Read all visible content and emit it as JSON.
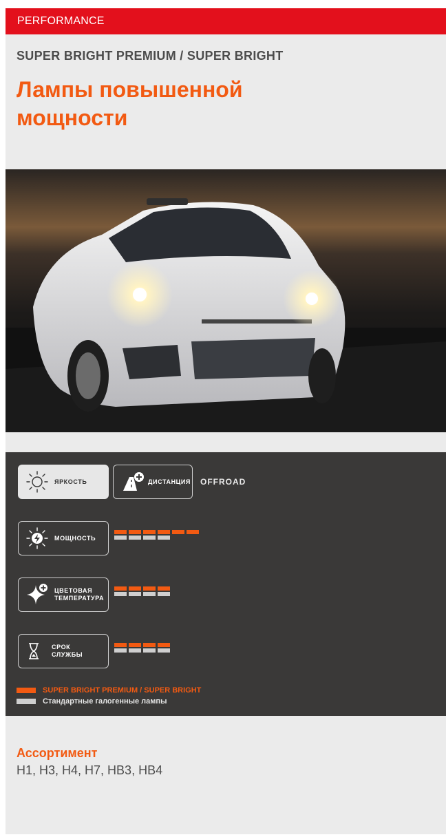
{
  "header": {
    "category": "PERFORMANCE"
  },
  "product": {
    "subtitle": "SUPER BRIGHT PREMIUM / SUPER BRIGHT",
    "title": "Лампы повышенной мощности"
  },
  "features": {
    "brightness_label": "ЯРКОСТЬ",
    "distance_label": "ДИСТАНЦИЯ",
    "offroad_label": "OFFROAD",
    "power": {
      "label": "МОЩНОСТЬ",
      "product_level": 6,
      "standard_level": 4
    },
    "color_temp": {
      "label_line1": "ЦВЕТОВАЯ",
      "label_line2": "ТЕМПЕРАТУРА",
      "product_level": 4,
      "standard_level": 4
    },
    "lifetime": {
      "label_line1": "СРОК",
      "label_line2": "СЛУЖБЫ",
      "product_level": 4,
      "standard_level": 4
    }
  },
  "legend": {
    "product": "SUPER BRIGHT PREMIUM / SUPER BRIGHT",
    "standard": "Стандартные галогенные лампы"
  },
  "assortment": {
    "heading": "Ассортимент",
    "values": "H1, H3, H4, H7, HB3, HB4"
  },
  "colors": {
    "brand_red": "#e3101c",
    "accent_orange": "#f25a12",
    "panel_dark": "#3a3938",
    "standard_grey": "#cfcfcf"
  },
  "icons": [
    "sun-icon",
    "road-plus-icon",
    "sun-bolt-icon",
    "star-plus-icon",
    "hourglass-icon"
  ]
}
